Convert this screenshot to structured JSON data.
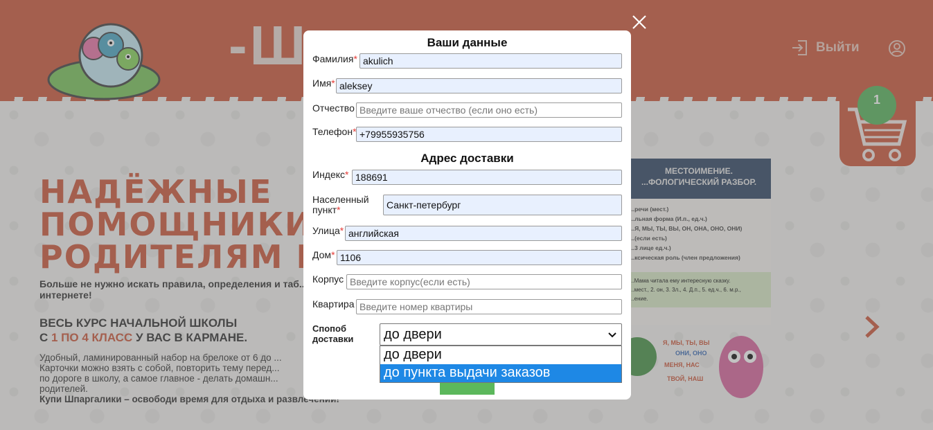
{
  "header": {
    "logo_text": "-Ш ...и -",
    "logout_label": "Выйти",
    "cart_count": "1"
  },
  "hero": {
    "title_lines": [
      "НАДЁЖНЫЕ",
      "ПОМОЩНИКИ",
      "РОДИТЕЛЯМ И ..."
    ],
    "paragraph": "Больше не нужно искать правила, определения и таб... интернете!",
    "course_line1": "ВЕСЬ КУРС НАЧАЛЬНОЙ ШКОЛЫ",
    "course_line2_pre": "С ",
    "course_line2_red": "1 ПО 4 КЛАСС",
    "course_line2_post": " У ВАС В КАРМАНЕ.",
    "desc_lines": [
      "Удобный, ламинированный набор на брелоке от 6 до ...",
      "Карточки можно взять с собой, повторить тему перед...",
      "по дороге в школу, а самое главное - делать домашн...",
      "родителей."
    ],
    "desc_bold": "Купи Шпаргалики – освободи время для отдыха и развлечений!"
  },
  "card": {
    "title_line1": "МЕСТОИМЕНИЕ.",
    "title_line2": "...ФОЛОГИЧЕСКИЙ РАЗБОР.",
    "lines": [
      "...речи (мест.)",
      "...льная форма (И.п., ед.ч.)",
      "...Я, МЫ, ТЫ, ВЫ, ОН, ОНА, ОНО, ОНИ)",
      "...(если есть)",
      "...3 лице ед.ч.)",
      "...ксическая роль (член предложения)"
    ],
    "example": "...Мама читала ему интересную сказку.",
    "example2": "...мест., 2. он, 3. 3л., 4. Д.п., 5. ед.ч., 6. м.р.,",
    "example3": "...ение.",
    "bubbles": [
      "Я, МЫ, ТЫ, ВЫ",
      "ОНИ, ОНО",
      "МЕНЯ, НАС",
      "ТВОЙ, НАШ"
    ]
  },
  "modal": {
    "title_personal": "Ваши данные",
    "title_address": "Адрес доставки",
    "fields": {
      "last_name": {
        "label": "Фамилия",
        "value": "akulich"
      },
      "first_name": {
        "label": "Имя",
        "value": "aleksey"
      },
      "patronymic": {
        "label": "Отчество",
        "placeholder": "Введите ваше отчество (если оно есть)"
      },
      "phone": {
        "label": "Телефон",
        "value": "+79955935756"
      },
      "index": {
        "label": "Индекс",
        "value": "188691"
      },
      "city": {
        "label_line1": "Населенный",
        "label_line2": "пункт",
        "value": "Санкт-петербург"
      },
      "street": {
        "label": "Улица",
        "value": "английская"
      },
      "house": {
        "label": "Дом",
        "value": "1106"
      },
      "building": {
        "label": "Корпус",
        "placeholder": "Введите корпус(если есть)"
      },
      "apartment": {
        "label": "Квартира",
        "placeholder": "Введите номер квартиры"
      }
    },
    "delivery": {
      "label_line1": "Спопоб",
      "label_line2": "доставки",
      "selected": "до двери",
      "options": [
        "до двери",
        "до пункта выдачи заказов"
      ],
      "highlighted_index": 1
    },
    "required_mark": "*"
  },
  "colors": {
    "brand_red": "#c94b2c",
    "accent_green": "#4caf50",
    "select_highlight": "#1e88e5",
    "autofill_bg": "#e8f0fe"
  }
}
